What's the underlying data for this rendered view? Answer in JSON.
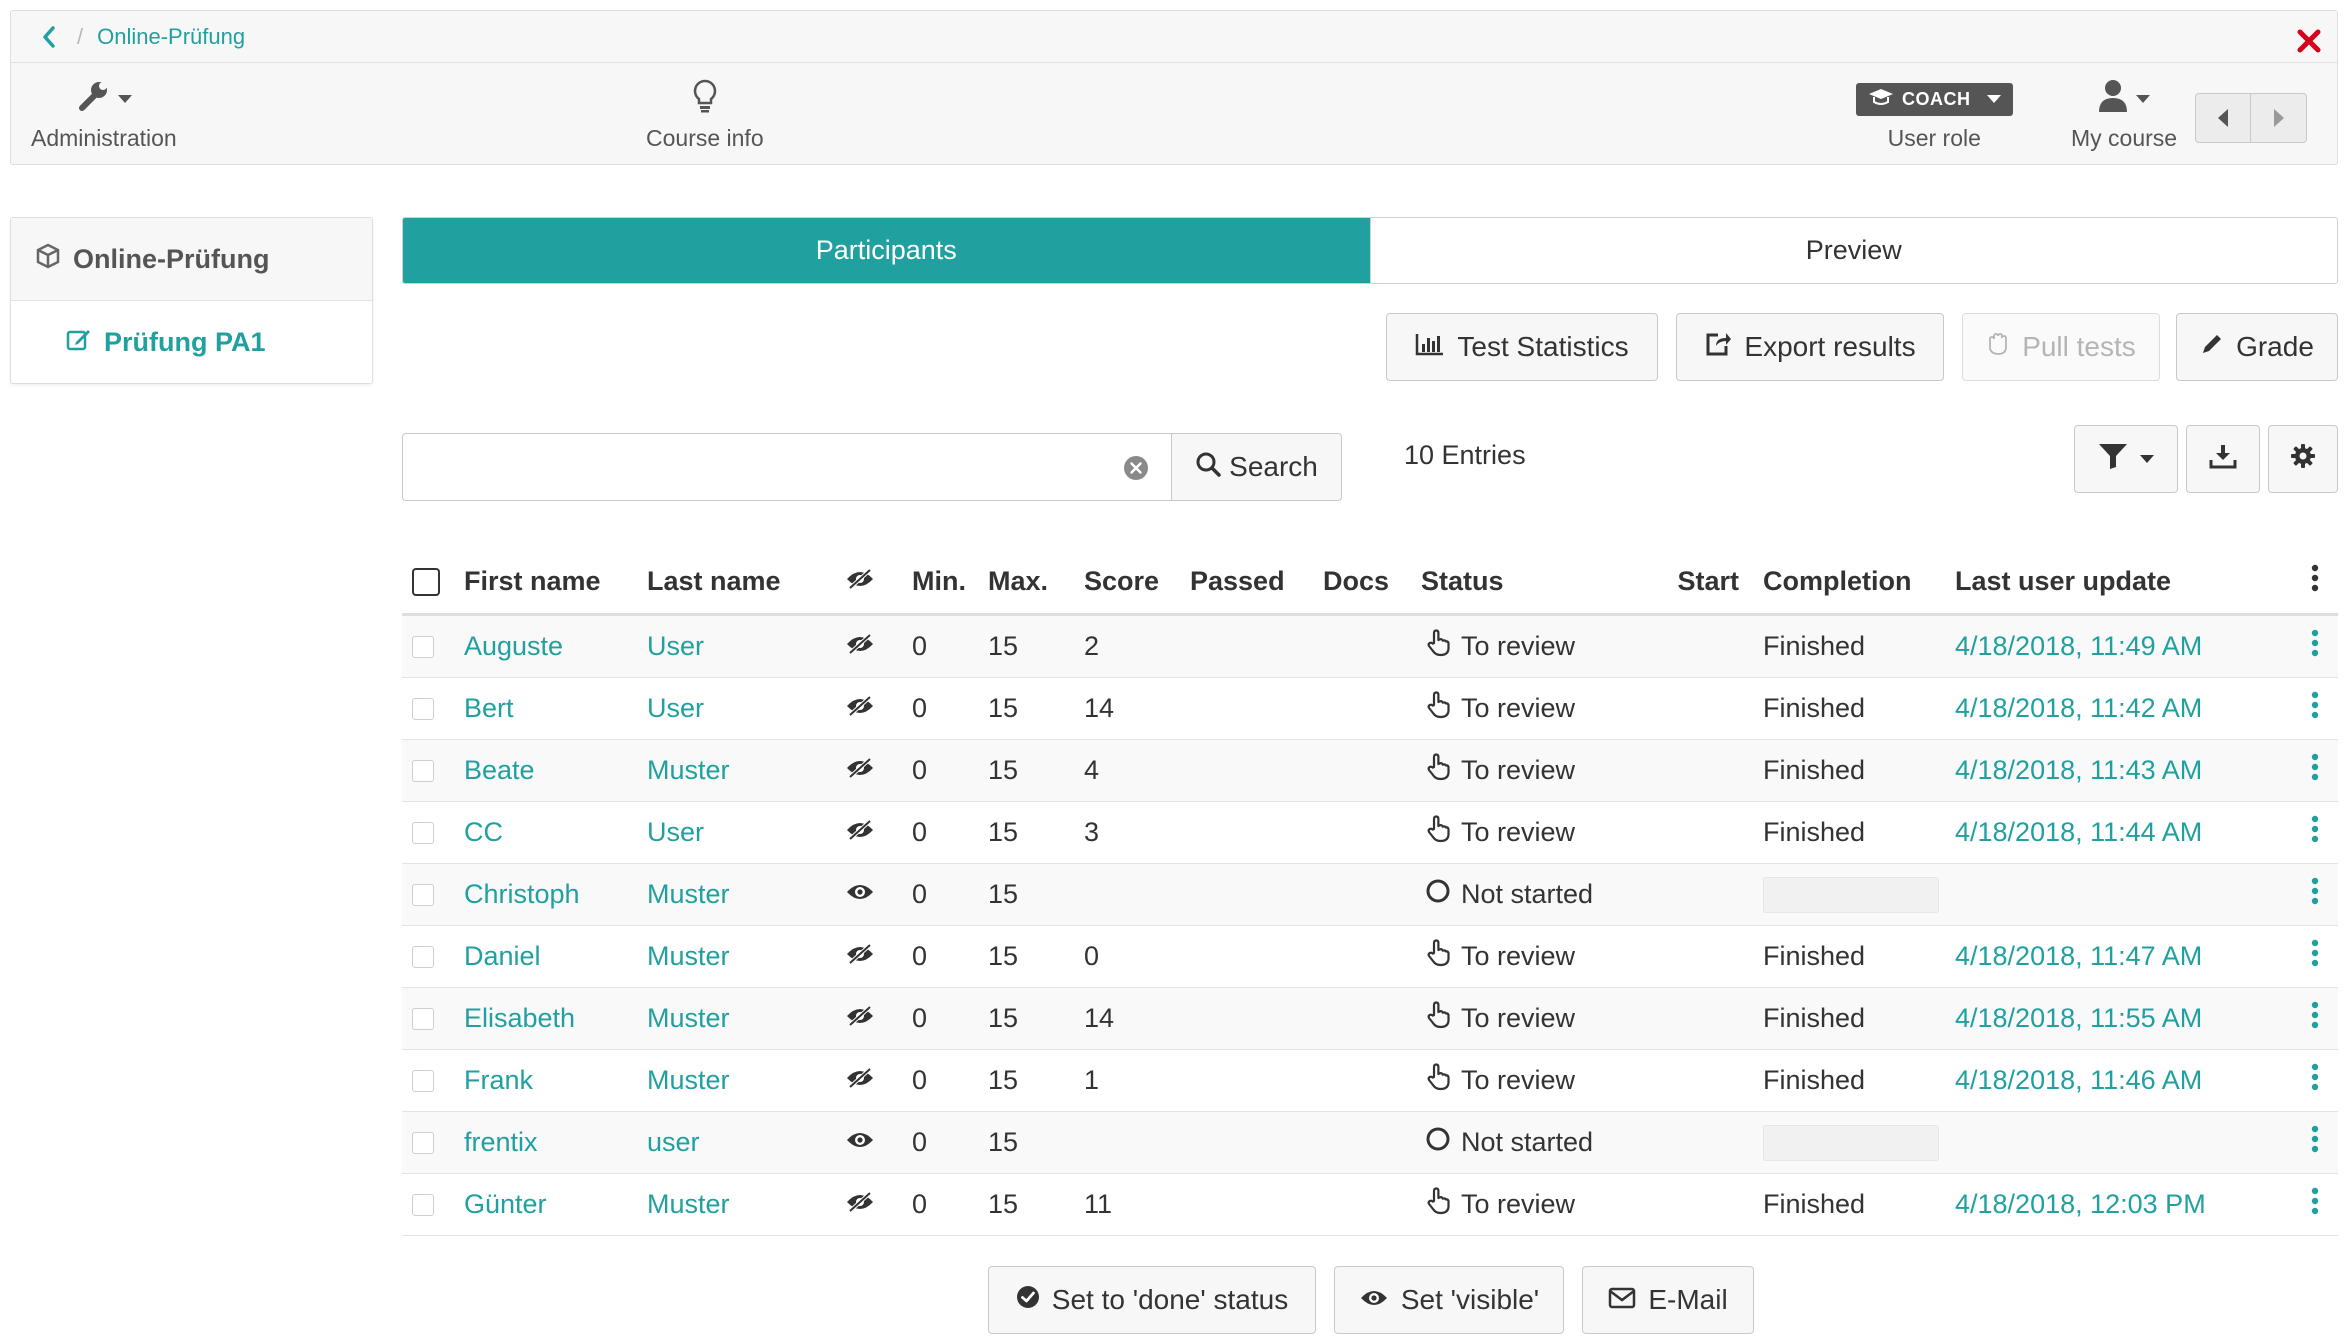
{
  "breadcrumb": {
    "current": "Online-Prüfung"
  },
  "toolbar": {
    "administration": "Administration",
    "course_info": "Course info",
    "role_badge": "COACH",
    "user_role": "User role",
    "my_course": "My course"
  },
  "left_menu": {
    "root": "Online-Prüfung",
    "child": "Prüfung PA1"
  },
  "tabs": {
    "participants": "Participants",
    "preview": "Preview"
  },
  "actions": {
    "test_statistics": "Test Statistics",
    "export_results": "Export results",
    "pull_tests": "Pull tests",
    "grade": "Grade"
  },
  "search": {
    "value": "",
    "placeholder": "",
    "button": "Search"
  },
  "entries": "10 Entries",
  "table": {
    "headers": {
      "first": "First name",
      "last": "Last name",
      "min": "Min.",
      "max": "Max.",
      "score": "Score",
      "passed": "Passed",
      "docs": "Docs",
      "status": "Status",
      "start": "Start",
      "completion": "Completion",
      "last_update": "Last user update"
    },
    "rows": [
      {
        "first": "Auguste",
        "last": "User",
        "visible": false,
        "min": "0",
        "max": "15",
        "score": "2",
        "status": "To review",
        "status_icon": "hand-pointer-icon",
        "completion": "Finished",
        "last_update": "4/18/2018, 11:49 AM"
      },
      {
        "first": "Bert",
        "last": "User",
        "visible": false,
        "min": "0",
        "max": "15",
        "score": "14",
        "status": "To review",
        "status_icon": "hand-pointer-icon",
        "completion": "Finished",
        "last_update": "4/18/2018, 11:42 AM"
      },
      {
        "first": "Beate",
        "last": "Muster",
        "visible": false,
        "min": "0",
        "max": "15",
        "score": "4",
        "status": "To review",
        "status_icon": "hand-pointer-icon",
        "completion": "Finished",
        "last_update": "4/18/2018, 11:43 AM"
      },
      {
        "first": "CC",
        "last": "User",
        "visible": false,
        "min": "0",
        "max": "15",
        "score": "3",
        "status": "To review",
        "status_icon": "hand-pointer-icon",
        "completion": "Finished",
        "last_update": "4/18/2018, 11:44 AM"
      },
      {
        "first": "Christoph",
        "last": "Muster",
        "visible": true,
        "min": "0",
        "max": "15",
        "score": "",
        "status": "Not started",
        "status_icon": "circle-icon",
        "completion": "",
        "last_update": ""
      },
      {
        "first": "Daniel",
        "last": "Muster",
        "visible": false,
        "min": "0",
        "max": "15",
        "score": "0",
        "status": "To review",
        "status_icon": "hand-pointer-icon",
        "completion": "Finished",
        "last_update": "4/18/2018, 11:47 AM"
      },
      {
        "first": "Elisabeth",
        "last": "Muster",
        "visible": false,
        "min": "0",
        "max": "15",
        "score": "14",
        "status": "To review",
        "status_icon": "hand-pointer-icon",
        "completion": "Finished",
        "last_update": "4/18/2018, 11:55 AM"
      },
      {
        "first": "Frank",
        "last": "Muster",
        "visible": false,
        "min": "0",
        "max": "15",
        "score": "1",
        "status": "To review",
        "status_icon": "hand-pointer-icon",
        "completion": "Finished",
        "last_update": "4/18/2018, 11:46 AM"
      },
      {
        "first": "frentix",
        "last": "user",
        "visible": true,
        "min": "0",
        "max": "15",
        "score": "",
        "status": "Not started",
        "status_icon": "circle-icon",
        "completion": "",
        "last_update": ""
      },
      {
        "first": "Günter",
        "last": "Muster",
        "visible": false,
        "min": "0",
        "max": "15",
        "score": "11",
        "status": "To review",
        "status_icon": "hand-pointer-icon",
        "completion": "Finished",
        "last_update": "4/18/2018, 12:03 PM"
      }
    ]
  },
  "bulk_actions": {
    "set_done": "Set to 'done' status",
    "set_visible": "Set 'visible'",
    "email": "E-Mail"
  },
  "colors": {
    "accent": "#21a0a0",
    "close": "#d9001b",
    "badge": "#555555"
  }
}
